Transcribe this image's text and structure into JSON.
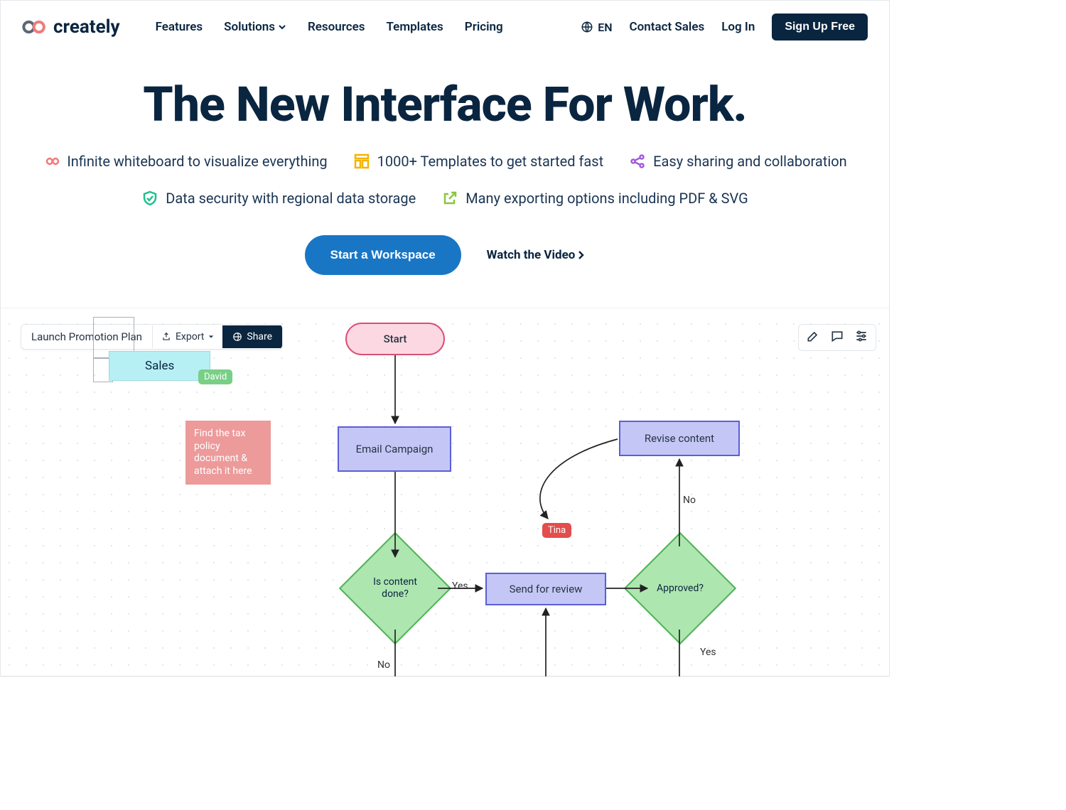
{
  "header": {
    "brand": "creately",
    "nav": {
      "features": "Features",
      "solutions": "Solutions",
      "resources": "Resources",
      "templates": "Templates",
      "pricing": "Pricing"
    },
    "lang": "EN",
    "contact": "Contact Sales",
    "login": "Log In",
    "signup": "Sign Up Free"
  },
  "hero": {
    "title": "The New Interface For Work.",
    "feat1": "Infinite whiteboard to visualize everything",
    "feat2": "1000+ Templates to get started fast",
    "feat3": "Easy sharing and collaboration",
    "feat4": "Data security with regional data storage",
    "feat5": "Many exporting options including PDF & SVG",
    "start": "Start a Workspace",
    "watch": "Watch the Video"
  },
  "preview": {
    "toolbar": {
      "title": "Launch Promotion Plan",
      "export": "Export",
      "share": "Share"
    },
    "sales": "Sales",
    "david": "David",
    "tina": "Tina",
    "sticky": "Find the tax policy document & attach it here",
    "start": "Start",
    "email": "Email Campaign",
    "contentdone": "Is content done?",
    "sendreview": "Send for review",
    "approved": "Approved?",
    "revise": "Revise content",
    "yes": "Yes",
    "yes2": "Yes",
    "no": "No",
    "no2": "No"
  }
}
